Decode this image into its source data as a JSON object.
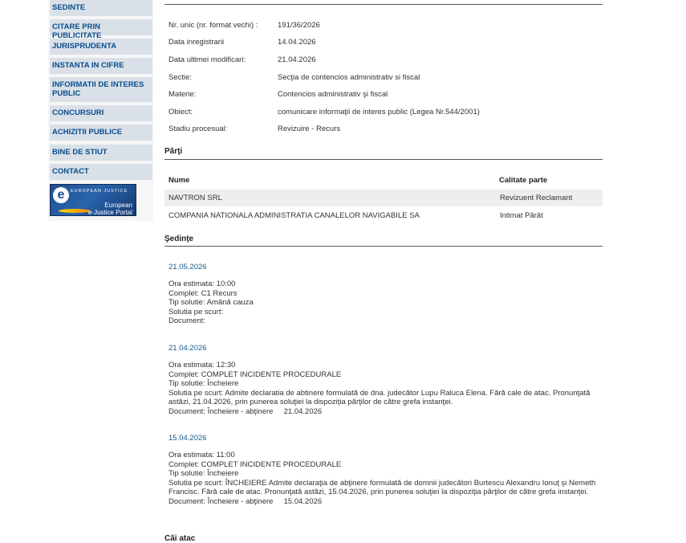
{
  "sidebar": {
    "items": [
      {
        "label": "SEDINTE"
      },
      {
        "label": "CITARE PRIN PUBLICITATE"
      },
      {
        "label": "JURISPRUDENTA"
      },
      {
        "label": "INSTANTA IN CIFRE"
      },
      {
        "label": "INFORMATII DE INTERES PUBLIC"
      },
      {
        "label": "CONCURSURI"
      },
      {
        "label": "ACHIZITII PUBLICE"
      },
      {
        "label": "BINE DE STIUT"
      },
      {
        "label": "CONTACT"
      }
    ],
    "ejustice": {
      "logo_letter": "e",
      "small_text": "EUROPEAN JUSTICE",
      "line1": "European",
      "line2": "e-Justice Portal"
    }
  },
  "dosar": {
    "fields": [
      {
        "label": "Nr. unic (nr. format vechi) :",
        "value": "191/36/2026"
      },
      {
        "label": "Data inregistrarii",
        "value": "14.04.2026"
      },
      {
        "label": "Data ultimei modificari:",
        "value": "21.04.2026"
      },
      {
        "label": "Sectie:",
        "value": "Secţia de contencios administrativ si fiscal"
      },
      {
        "label": "Materie:",
        "value": "Contencios administrativ şi fiscal"
      },
      {
        "label": "Obiect:",
        "value": "comunicare informaţii de interes public (Legea Nr.544/2001)"
      },
      {
        "label": "Stadiu procesual:",
        "value": "Revizuire - Recurs"
      }
    ]
  },
  "parti": {
    "title": "Părţi",
    "headers": {
      "name": "Nume",
      "role": "Calitate parte"
    },
    "rows": [
      {
        "name": "NAVTRON SRL",
        "role": "Revizuent Reclamant"
      },
      {
        "name": "COMPANIA NATIONALA ADMINISTRATIA CANALELOR NAVIGABILE SA",
        "role": "Intimat Pârât"
      }
    ]
  },
  "sedinte": {
    "title": "Şedinţe",
    "items": [
      {
        "date": "21.05.2026",
        "ora": "Ora estimata: 10:00",
        "complet": "Complet: C1 Recurs",
        "tip": "Tip solutie: Amână cauza",
        "solutie": "Solutia pe scurt:",
        "document": "Document:"
      },
      {
        "date": "21.04.2026",
        "ora": "Ora estimata: 12:30",
        "complet": "Complet: COMPLET INCIDENTE PROCEDURALE",
        "tip": "Tip solutie: Încheiere",
        "solutie": "Solutia pe scurt: Admite declaratia de abtinere formulată de dna. judecător Lupu Raluca Elena. Fără cale de atac. Pronunţată astăzi, 21.04.2026, prin punerea soluţiei la dispoziţia părţilor de către grefa instanţei.",
        "document": "Document: Încheiere - abţinere     21.04.2026"
      },
      {
        "date": "15.04.2026",
        "ora": "Ora estimata: 11:00",
        "complet": "Complet: COMPLET INCIDENTE PROCEDURALE",
        "tip": "Tip solutie: Încheiere",
        "solutie": "Solutia pe scurt: ÎNCHEIERE Admite declaraţia de abţinere formulată de domnii judecători Burtescu Alexandru Ionuţ şi Nemeth Francisc. Fără cale de atac. Pronunţată astăzi, 15.04.2026, prin punerea soluţiei la dispoziţia părţilor de către grefa instanţei.",
        "document": "Document: Încheiere - abţinere     15.04.2026"
      }
    ]
  },
  "cai_atac": {
    "title": "Căi atac"
  }
}
